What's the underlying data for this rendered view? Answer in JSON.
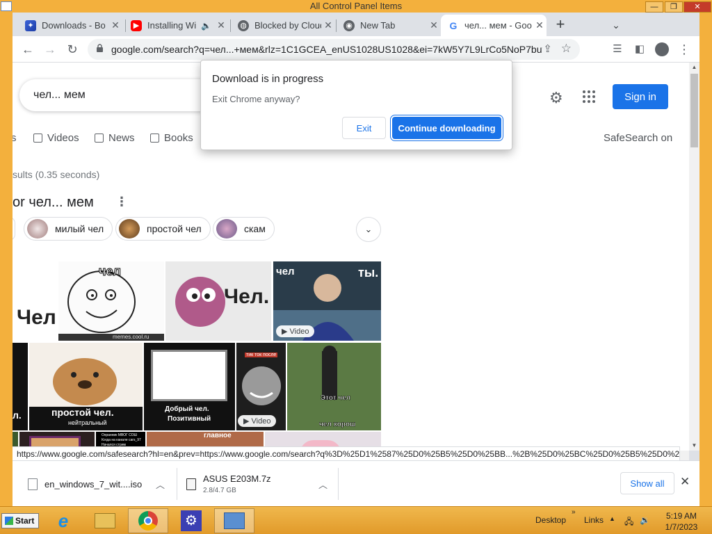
{
  "window": {
    "title": "All Control Panel Items"
  },
  "tabs": [
    {
      "title": "Downloads - Bo",
      "favicon": "edge-like-blue"
    },
    {
      "title": "Installing Wi",
      "favicon": "youtube-red"
    },
    {
      "title": "Blocked by Cloud",
      "favicon": "globe"
    },
    {
      "title": "New Tab",
      "favicon": "chrome"
    },
    {
      "title": "чел... мем - Goo",
      "favicon": "google",
      "active": true
    }
  ],
  "toolbar": {
    "url": "google.com/search?q=чел...+мем&rlz=1C1GCEA_enUS1028US1028&ei=7kW5Y7L9LrCo5NoP7buyyA..."
  },
  "google": {
    "query": "чел... мем",
    "signin_label": "Sign in",
    "nav": [
      "s",
      "Videos",
      "News",
      "Books"
    ],
    "safesearch": "SafeSearch on",
    "result_stats": "sults (0.35 seconds)",
    "images_heading": "or чел... мем",
    "chips": [
      "милый чел",
      "простой чел",
      "скам"
    ],
    "tiles": {
      "t1": "Чел",
      "t2": "чел",
      "t2_site": "memes.cool.ru",
      "t3": "Чел.",
      "t4_left": "чел",
      "t4_right": "ты.",
      "t5": "простой чел.",
      "t5_sub": "нейтральный",
      "t6": "Добрый чел.",
      "t6_sub": "Позитивный",
      "t7_top": "тик ток после",
      "t8": "Этот чел",
      "t8_sub": "чел хорош",
      "t10_top": "Охранник МВОГ СОШ",
      "t10_mid": "Когда на канале cars_97",
      "t10_bot": "Начался стрим",
      "t12": "главное"
    },
    "video_badge": "Video"
  },
  "dialog": {
    "title": "Download is in progress",
    "message": "Exit Chrome anyway?",
    "exit_label": "Exit",
    "continue_label": "Continue downloading"
  },
  "status_url": "https://www.google.com/safesearch?hl=en&prev=https://www.google.com/search?q%3D%25D1%2587%25D0%25B5%25D0%25BB...%2B%25D0%25BC%25D0%25B5%25D0%25...",
  "downloads": [
    {
      "name": "en_windows_7_wit....iso",
      "progress": ""
    },
    {
      "name": "ASUS E203M.7z",
      "progress": "2.8/4.7 GB"
    }
  ],
  "show_all": "Show all",
  "taskbar": {
    "start": "Start",
    "desktop": "Desktop",
    "links": "Links",
    "time": "5:19 AM",
    "date": "1/7/2023"
  },
  "colors": {
    "accent": "#1a73e8",
    "taskbar": "#e9a93b"
  }
}
